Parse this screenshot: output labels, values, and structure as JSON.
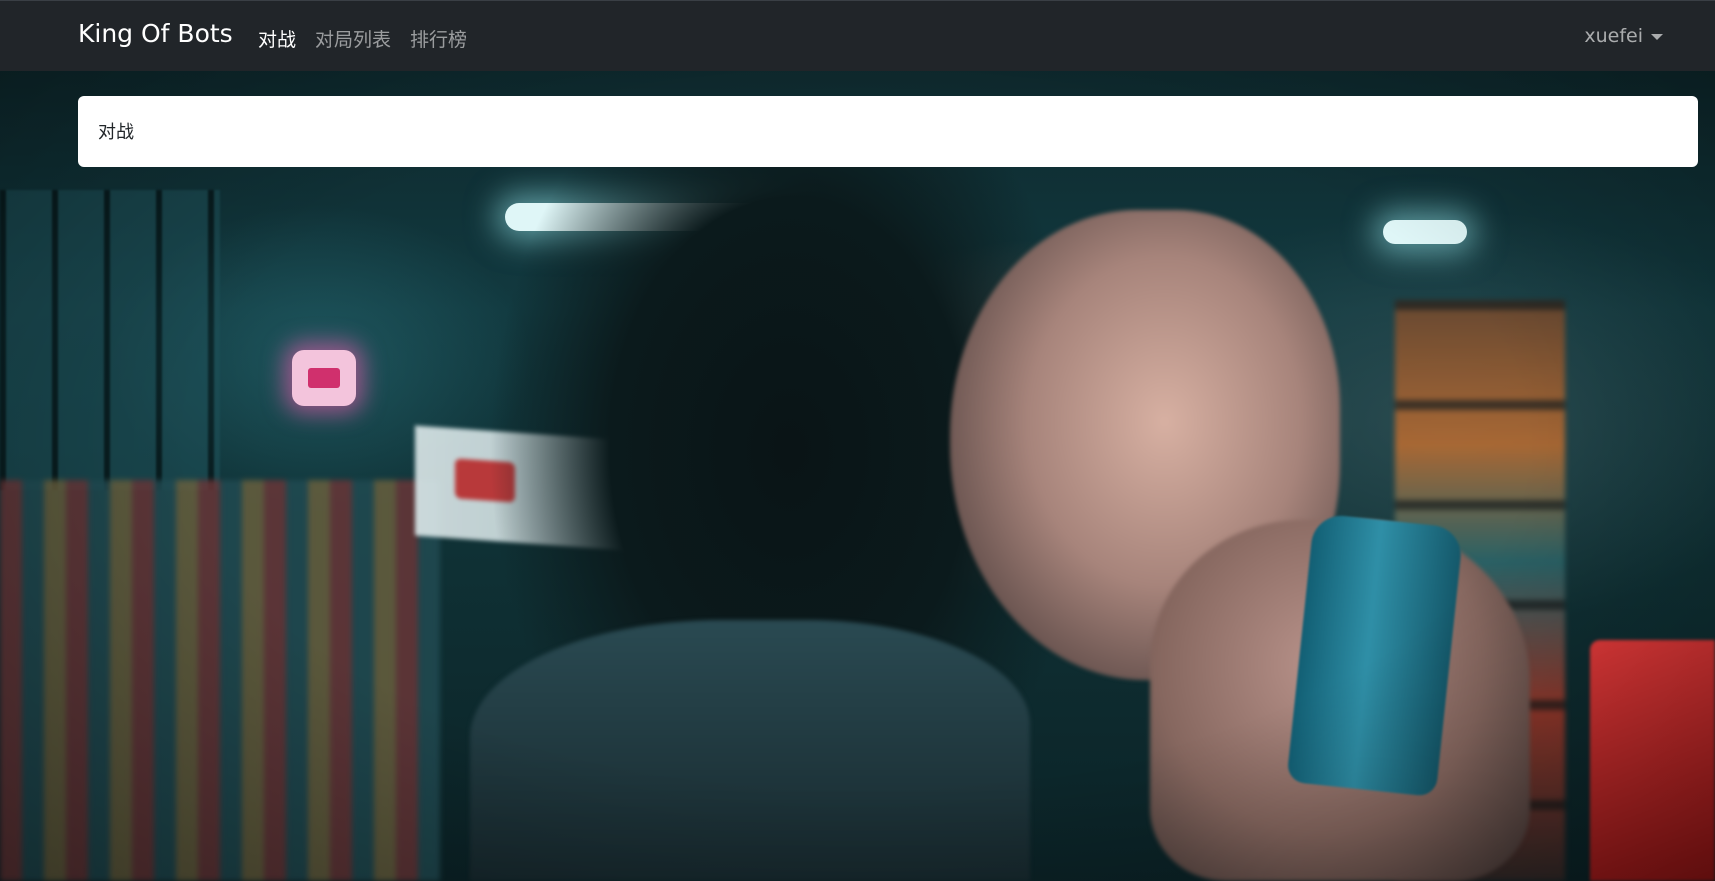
{
  "navbar": {
    "brand": "King Of Bots",
    "links": [
      {
        "label": "对战",
        "active": true
      },
      {
        "label": "对局列表",
        "active": false
      },
      {
        "label": "排行榜",
        "active": false
      }
    ],
    "user": {
      "name": "xuefei",
      "dropdown_icon": "caret-down-icon"
    }
  },
  "main": {
    "card_text": "对战"
  },
  "colors": {
    "navbar_bg": "#212529",
    "card_bg": "#ffffff",
    "nav_active": "#ffffff",
    "nav_inactive": "rgba(255,255,255,0.55)"
  },
  "background": {
    "type": "photo",
    "icon": "background-photo"
  }
}
